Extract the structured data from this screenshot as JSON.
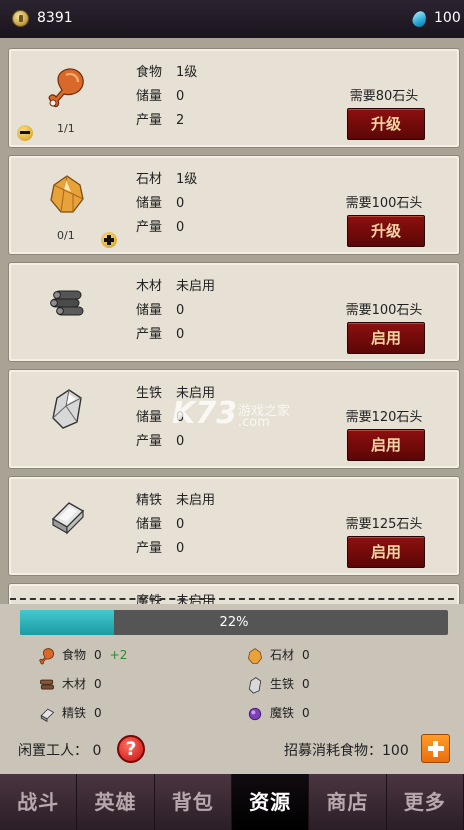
{
  "top": {
    "gold": "8391",
    "gems": "100",
    "icons": [
      "coin-icon",
      "gem-icon"
    ]
  },
  "cards": [
    {
      "name": "食物",
      "status": "1级",
      "storage_label": "储量",
      "storage": "0",
      "output_label": "产量",
      "output": "2",
      "counter": "1/1",
      "cost": "需要80石头",
      "button": "升级",
      "icon": "drumstick-icon",
      "stepper": "minus"
    },
    {
      "name": "石材",
      "status": "1级",
      "storage_label": "储量",
      "storage": "0",
      "output_label": "产量",
      "output": "0",
      "counter": "0/1",
      "cost": "需要100石头",
      "button": "升级",
      "icon": "stone-ore-icon",
      "stepper": "plus"
    },
    {
      "name": "木材",
      "status": "未启用",
      "storage_label": "储量",
      "storage": "0",
      "output_label": "产量",
      "output": "0",
      "cost": "需要100石头",
      "button": "启用",
      "icon": "logs-icon"
    },
    {
      "name": "生铁",
      "status": "未启用",
      "storage_label": "储量",
      "storage": "0",
      "output_label": "产量",
      "output": "0",
      "cost": "需要120石头",
      "button": "启用",
      "icon": "iron-ore-icon"
    },
    {
      "name": "精铁",
      "status": "未启用",
      "storage_label": "储量",
      "storage": "0",
      "output_label": "产量",
      "output": "0",
      "cost": "需要125石头",
      "button": "启用",
      "icon": "iron-ingot-icon"
    }
  ],
  "partial_card": {
    "name": "魔铁",
    "status": "未启用"
  },
  "watermark": {
    "brand": "K73",
    "cn": "游戏之家",
    "domain": ".com"
  },
  "progress": {
    "value": 0.22,
    "label": "22%"
  },
  "inventory": [
    {
      "name": "食物",
      "value": "0",
      "delta": "+2",
      "icon": "drumstick-icon"
    },
    {
      "name": "石材",
      "value": "0",
      "icon": "stone-ore-icon"
    },
    {
      "name": "木材",
      "value": "0",
      "icon": "logs-icon"
    },
    {
      "name": "生铁",
      "value": "0",
      "icon": "iron-ore-icon"
    },
    {
      "name": "精铁",
      "value": "0",
      "icon": "iron-ingot-icon"
    },
    {
      "name": "魔铁",
      "value": "0",
      "icon": "magic-iron-icon"
    }
  ],
  "workers": {
    "idle_label": "闲置工人：",
    "idle_value": "0",
    "recruit_label": "招募消耗食物：",
    "recruit_value": "100"
  },
  "nav": [
    {
      "label": "战斗"
    },
    {
      "label": "英雄"
    },
    {
      "label": "背包"
    },
    {
      "label": "资源",
      "active": true
    },
    {
      "label": "商店"
    },
    {
      "label": "更多"
    }
  ],
  "colors": {
    "accent_button": "#7a0b0b",
    "progress": "#2fb4bb",
    "nav_bg": "#3a2a33"
  }
}
